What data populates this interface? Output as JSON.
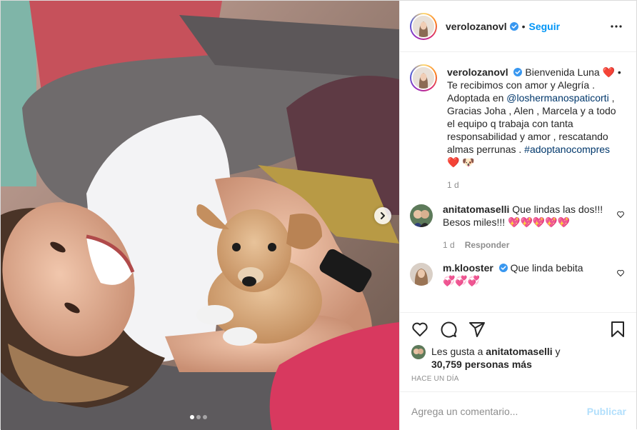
{
  "post": {
    "username": "verolozanovl",
    "follow_label": "Seguir",
    "separator": "•",
    "more_icon": "more-horizontal-icon",
    "image_nav_icon": "chevron-right-icon",
    "carousel": {
      "count": 3,
      "active_index": 0
    }
  },
  "caption": {
    "username": "verolozanovl",
    "text_part1": "Bienvenida Luna ",
    "heart": "❤️",
    "text_part2": " • Te recibimos con amor y Alegría . Adoptada en ",
    "mention": "@loshermanospaticorti",
    "text_part3": " , Gracias Joha , Alen , Marcela y a todo el equipo q trabaja con tanta responsabilidad y amor , rescatando almas perrunas . ",
    "hashtag": "#adoptanocompres",
    "emoji_line": "❤️ 🐶",
    "time": "1 d"
  },
  "comments": [
    {
      "username": "anitatomaselli",
      "text": "Que lindas las dos!!! Besos miles!!!",
      "emojis": "💖💖💖💖💖",
      "time": "1 d",
      "reply_label": "Responder"
    },
    {
      "username": "m.klooster",
      "text": "Que linda bebita",
      "emojis": "💞💞💞",
      "verified": true
    }
  ],
  "likes": {
    "prefix": "Les gusta a ",
    "user": "anitatomaselli",
    "middle": " y",
    "count_text": "30,759 personas más"
  },
  "timestamp": "Hace un día",
  "add_comment": {
    "placeholder": "Agrega un comentario...",
    "publish_label": "Publicar"
  },
  "colors": {
    "accent_blue": "#0095f6",
    "link_blue": "#00376b",
    "muted": "#8e8e8e",
    "publish_disabled": "#b2dffc"
  }
}
